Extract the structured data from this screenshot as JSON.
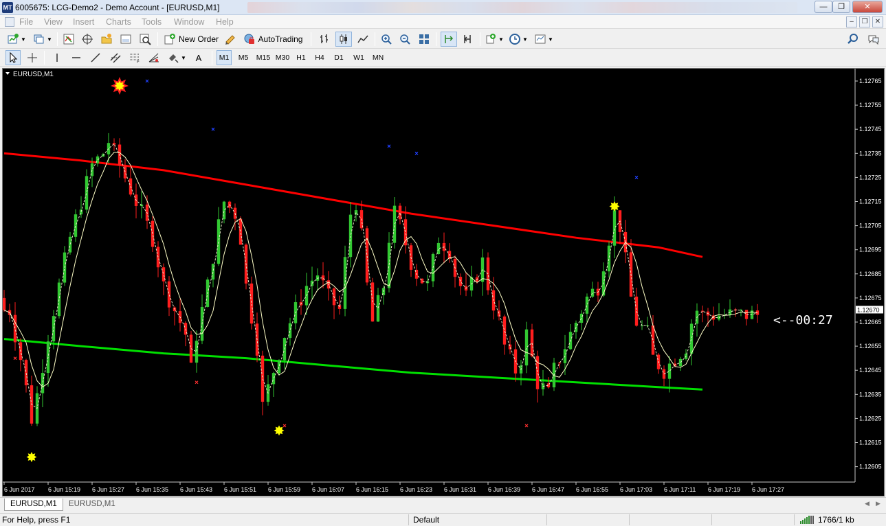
{
  "window": {
    "title": "6005675: LCG-Demo2 - Demo Account - [EURUSD,M1]",
    "minimize_glyph": "—",
    "restore_glyph": "❐",
    "close_glyph": "✕"
  },
  "menu": {
    "items": [
      "File",
      "View",
      "Insert",
      "Charts",
      "Tools",
      "Window",
      "Help"
    ]
  },
  "toolbar": {
    "new_order_label": "New Order",
    "autotrading_label": "AutoTrading",
    "timeframes": [
      "M1",
      "M5",
      "M15",
      "M30",
      "H1",
      "H4",
      "D1",
      "W1",
      "MN"
    ],
    "text_tool_label": "A"
  },
  "chart": {
    "label": "EURUSD,M1",
    "countdown": "<--00:27",
    "current_price_tag": "1.12670",
    "colors": {
      "bull": "#32c832",
      "bear": "#ff1e1e",
      "upper_line": "#ff0000",
      "lower_line": "#00e000",
      "ma": "#ffffc8",
      "signal": "#ffff00"
    }
  },
  "chart_data": {
    "type": "candlestick",
    "symbol": "EURUSD",
    "timeframe": "M1",
    "y_ticks": [
      "1.12765",
      "1.12755",
      "1.12745",
      "1.12735",
      "1.12725",
      "1.12715",
      "1.12705",
      "1.12695",
      "1.12685",
      "1.12675",
      "1.12665",
      "1.12655",
      "1.12645",
      "1.12635",
      "1.12625",
      "1.12615",
      "1.12605"
    ],
    "ylim": [
      1.126,
      1.1277
    ],
    "x_ticks": [
      "6 Jun 2017",
      "6 Jun 15:19",
      "6 Jun 15:27",
      "6 Jun 15:35",
      "6 Jun 15:43",
      "6 Jun 15:51",
      "6 Jun 15:59",
      "6 Jun 16:07",
      "6 Jun 16:15",
      "6 Jun 16:23",
      "6 Jun 16:31",
      "6 Jun 16:39",
      "6 Jun 16:47",
      "6 Jun 16:55",
      "6 Jun 17:03",
      "6 Jun 17:11",
      "6 Jun 17:19",
      "6 Jun 17:27"
    ],
    "minutes_per_x_tick": 8,
    "first_x_tick_minute": 911,
    "last_minute": 1048,
    "candle_width_minutes": 0.55,
    "current_price": 1.1267,
    "close_path": [
      [
        912,
        1.1267
      ],
      [
        913,
        1.1266
      ],
      [
        914,
        1.1265
      ],
      [
        916,
        1.12625
      ],
      [
        917,
        1.12635
      ],
      [
        919,
        1.1266
      ],
      [
        921,
        1.1268
      ],
      [
        923,
        1.127
      ],
      [
        925,
        1.12715
      ],
      [
        927,
        1.1273
      ],
      [
        929,
        1.12735
      ],
      [
        930,
        1.1274
      ],
      [
        932,
        1.1273
      ],
      [
        934,
        1.1272
      ],
      [
        936,
        1.1271
      ],
      [
        938,
        1.127
      ],
      [
        939,
        1.1269
      ],
      [
        940,
        1.1268
      ],
      [
        942,
        1.1267
      ],
      [
        944,
        1.1266
      ],
      [
        945,
        1.12645
      ],
      [
        946,
        1.1266
      ],
      [
        948,
        1.1268
      ],
      [
        950,
        1.12705
      ],
      [
        951,
        1.12715
      ],
      [
        953,
        1.1271
      ],
      [
        954,
        1.127
      ],
      [
        955,
        1.1268
      ],
      [
        957,
        1.12655
      ],
      [
        958,
        1.1263
      ],
      [
        960,
        1.12645
      ],
      [
        962,
        1.1266
      ],
      [
        964,
        1.1267
      ],
      [
        966,
        1.1268
      ],
      [
        968,
        1.12685
      ],
      [
        970,
        1.12675
      ],
      [
        972,
        1.1267
      ],
      [
        973,
        1.1269
      ],
      [
        974,
        1.1271
      ],
      [
        975,
        1.12715
      ],
      [
        976,
        1.127
      ],
      [
        977,
        1.1268
      ],
      [
        978,
        1.12665
      ],
      [
        980,
        1.1268
      ],
      [
        981,
        1.127
      ],
      [
        982,
        1.1271
      ],
      [
        983,
        1.12705
      ],
      [
        985,
        1.1269
      ],
      [
        986,
        1.12685
      ],
      [
        988,
        1.1268
      ],
      [
        989,
        1.1269
      ],
      [
        990,
        1.127
      ],
      [
        992,
        1.12695
      ],
      [
        993,
        1.12685
      ],
      [
        995,
        1.12675
      ],
      [
        996,
        1.1268
      ],
      [
        998,
        1.1269
      ],
      [
        999,
        1.1268
      ],
      [
        1001,
        1.12665
      ],
      [
        1002,
        1.12655
      ],
      [
        1004,
        1.12645
      ],
      [
        1005,
        1.1265
      ],
      [
        1006,
        1.1266
      ],
      [
        1007,
        1.1265
      ],
      [
        1008,
        1.1264
      ],
      [
        1010,
        1.12635
      ],
      [
        1011,
        1.12645
      ],
      [
        1013,
        1.12655
      ],
      [
        1015,
        1.12665
      ],
      [
        1017,
        1.12675
      ],
      [
        1019,
        1.1268
      ],
      [
        1020,
        1.1269
      ],
      [
        1021,
        1.127
      ],
      [
        1022,
        1.1271
      ],
      [
        1023,
        1.12705
      ],
      [
        1024,
        1.1269
      ],
      [
        1025,
        1.12675
      ],
      [
        1026,
        1.12665
      ],
      [
        1028,
        1.1266
      ],
      [
        1029,
        1.1265
      ],
      [
        1031,
        1.12645
      ],
      [
        1033,
        1.1265
      ],
      [
        1035,
        1.12655
      ],
      [
        1036,
        1.12665
      ],
      [
        1037,
        1.1267
      ],
      [
        1038,
        1.12668
      ]
    ],
    "upper_band": [
      [
        911,
        1.12735
      ],
      [
        925,
        1.12732
      ],
      [
        940,
        1.12728
      ],
      [
        955,
        1.12722
      ],
      [
        970,
        1.12716
      ],
      [
        985,
        1.1271
      ],
      [
        1000,
        1.12705
      ],
      [
        1015,
        1.127
      ],
      [
        1030,
        1.12696
      ],
      [
        1038,
        1.12692
      ]
    ],
    "lower_band": [
      [
        911,
        1.12658
      ],
      [
        925,
        1.12655
      ],
      [
        940,
        1.12652
      ],
      [
        955,
        1.1265
      ],
      [
        970,
        1.12647
      ],
      [
        985,
        1.12644
      ],
      [
        1000,
        1.12642
      ],
      [
        1015,
        1.1264
      ],
      [
        1030,
        1.12638
      ],
      [
        1038,
        1.12637
      ]
    ],
    "signals_yellow": [
      [
        916,
        1.12609
      ],
      [
        932,
        1.12763
      ],
      [
        961,
        1.1262
      ],
      [
        1022,
        1.12713
      ]
    ],
    "red_star_marker": [
      932,
      1.12763
    ],
    "cross_red": [
      [
        913,
        1.1265
      ],
      [
        946,
        1.1264
      ],
      [
        962,
        1.12622
      ],
      [
        1006,
        1.12622
      ]
    ],
    "cross_blue": [
      [
        931,
        1.12771
      ],
      [
        937,
        1.12765
      ],
      [
        949,
        1.12745
      ],
      [
        981,
        1.12738
      ],
      [
        986,
        1.12735
      ],
      [
        1026,
        1.12725
      ]
    ]
  },
  "tabs": [
    "EURUSD,M1",
    "EURUSD,M1"
  ],
  "status": {
    "help": "For Help, press F1",
    "profile": "Default",
    "traffic": "1766/1 kb"
  }
}
